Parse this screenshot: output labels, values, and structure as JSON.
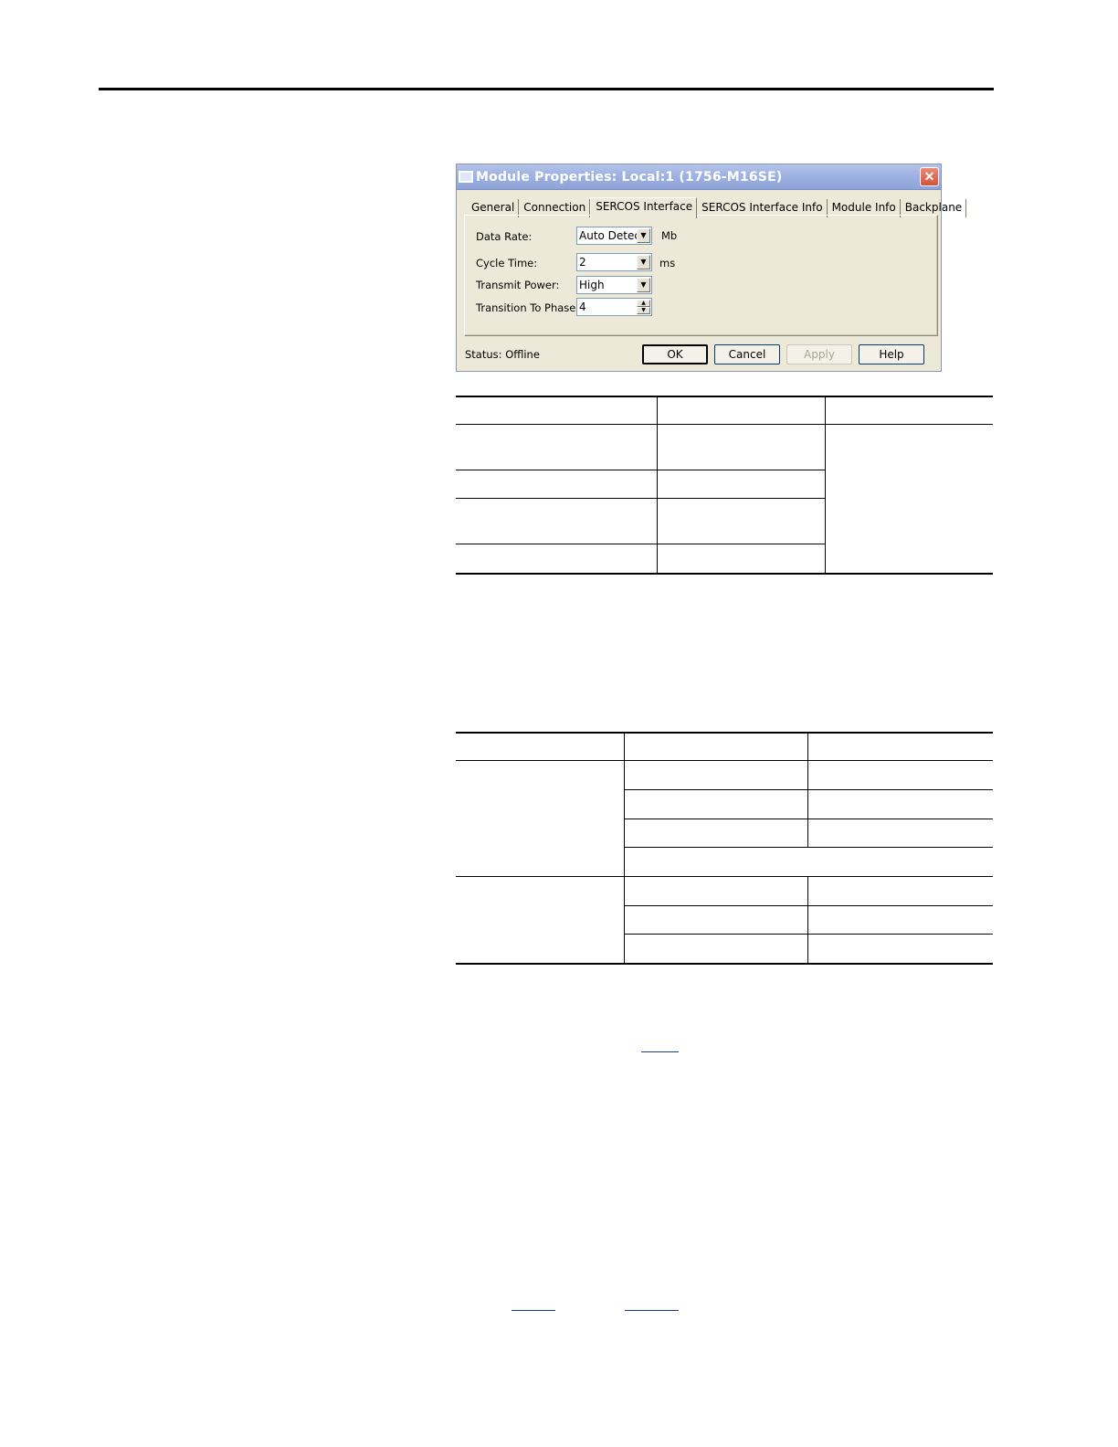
{
  "dialog": {
    "title": "Module Properties: Local:1 (1756-M16SE)",
    "close_glyph": "✕",
    "tabs": [
      "General",
      "Connection",
      "SERCOS Interface",
      "SERCOS Interface Info",
      "Module Info",
      "Backplane"
    ],
    "active_tab": "SERCOS Interface",
    "fields": {
      "data_rate": {
        "label": "Data Rate:",
        "value": "Auto Detect",
        "unit": "Mb"
      },
      "cycle_time": {
        "label": "Cycle Time:",
        "value": "2",
        "unit": "ms"
      },
      "transmit_power": {
        "label": "Transmit Power:",
        "value": "High"
      },
      "transition_to_phase": {
        "label": "Transition To Phase:",
        "value": "4"
      }
    },
    "status_label": "Status:",
    "status_value": "Offline",
    "buttons": {
      "ok": "OK",
      "cancel": "Cancel",
      "apply": "Apply",
      "help": "Help"
    },
    "icons": {
      "dropdown": "▼",
      "spin_up": "▲",
      "spin_down": "▼"
    }
  }
}
